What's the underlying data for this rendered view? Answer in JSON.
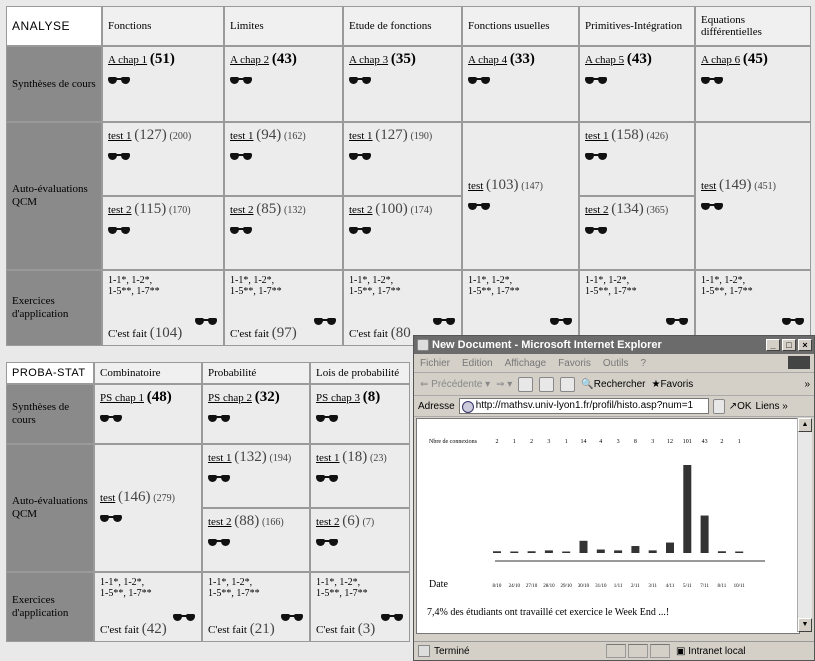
{
  "analyse": {
    "corner": "ANALYSE",
    "headers": [
      "Fonctions",
      "Limites",
      "Etude de fonctions",
      "Fonctions usuelles",
      "Primitives-Intégration",
      "Equations différentielles"
    ],
    "row_syntheses": "Synthèses de cours",
    "row_qcm": "Auto-évaluations QCM",
    "row_exercices": "Exercices d'application",
    "syntheses": [
      {
        "link": "A chap 1",
        "count": "(51)"
      },
      {
        "link": "A chap 2",
        "count": "(43)"
      },
      {
        "link": "A chap 3",
        "count": "(35)"
      },
      {
        "link": "A chap 4",
        "count": "(33)"
      },
      {
        "link": "A chap 5",
        "count": "(43)"
      },
      {
        "link": "A chap 6",
        "count": "(45)"
      }
    ],
    "test1": [
      {
        "link": "test 1",
        "count": "(127)",
        "total": "(200)"
      },
      {
        "link": "test 1",
        "count": "(94)",
        "total": "(162)"
      },
      {
        "link": "test 1",
        "count": "(127)",
        "total": "(190)"
      },
      {
        "link": "",
        "count": "",
        "total": ""
      },
      {
        "link": "test 1",
        "count": "(158)",
        "total": "(426)"
      },
      {
        "link": "",
        "count": "",
        "total": ""
      }
    ],
    "test2": [
      {
        "link": "test 2",
        "count": "(115)",
        "total": "(170)"
      },
      {
        "link": "test 2",
        "count": "(85)",
        "total": "(132)"
      },
      {
        "link": "test 2",
        "count": "(100)",
        "total": "(174)"
      },
      {
        "link": "",
        "count": "",
        "total": ""
      },
      {
        "link": "test 2",
        "count": "(134)",
        "total": "(365)"
      },
      {
        "link": "",
        "count": "",
        "total": ""
      }
    ],
    "single_tests": {
      "col4": {
        "link": "test",
        "count": "(103)",
        "total": "(147)"
      },
      "col6": {
        "link": "test",
        "count": "(149)",
        "total": "(451)"
      }
    },
    "exercices_line1": "1-1*, 1-2*,",
    "exercices_line2": "1-5**, 1-7**",
    "done_label": "C'est fait",
    "done_counts": [
      "(104)",
      "(97)",
      "(80"
    ]
  },
  "proba": {
    "corner": "PROBA-STAT",
    "headers": [
      "Combinatoire",
      "Probabilité",
      "Lois de probabilité"
    ],
    "row_syntheses": "Synthèses de cours",
    "row_qcm": "Auto-évaluations QCM",
    "row_exercices": "Exercices d'application",
    "syntheses": [
      {
        "link": "PS chap 1",
        "count": "(48)"
      },
      {
        "link": "PS chap 2",
        "count": "(32)"
      },
      {
        "link": "PS chap 3",
        "count": "(8)"
      }
    ],
    "single_test": {
      "link": "test",
      "count": "(146)",
      "total": "(279)"
    },
    "test1": [
      {
        "link": "test 1",
        "count": "(132)",
        "total": "(194)"
      },
      {
        "link": "test 1",
        "count": "(18)",
        "total": "(23)"
      }
    ],
    "test2": [
      {
        "link": "test 2",
        "count": "(88)",
        "total": "(166)"
      },
      {
        "link": "test 2",
        "count": "(6)",
        "total": "(7)"
      }
    ],
    "exercices_line1": "1-1*, 1-2*,",
    "exercices_line2": "1-5**, 1-7**",
    "done_label": "C'est fait",
    "done_counts": [
      "(42)",
      "(21)",
      "(3)"
    ]
  },
  "ie": {
    "title": "New Document - Microsoft Internet Explorer",
    "menu": [
      "Fichier",
      "Edition",
      "Affichage",
      "Favoris",
      "Outils",
      "?"
    ],
    "toolbar": {
      "back": "Précédente",
      "search": "Rechercher",
      "favorites": "Favoris"
    },
    "address_label": "Adresse",
    "address_value": "http://mathsv.univ-lyon1.fr/profil/histo.asp?num=1",
    "go_label": "OK",
    "links_label": "Liens",
    "status_text": "Terminé",
    "zone_text": "Intranet local",
    "page": {
      "note": "7,4% des étudiants ont travaillé cet exercice le Week End ...!"
    }
  },
  "chart_data": {
    "type": "bar",
    "title": "",
    "ylabel": "Nbre de connexions",
    "xlabel": "Date",
    "categories": [
      "8/10",
      "24/10",
      "27/10",
      "28/10",
      "29/10",
      "30/10",
      "31/10",
      "1/11",
      "2/11",
      "3/11",
      "4/11",
      "5/11",
      "7/11",
      "8/11",
      "10/11"
    ],
    "values": [
      2,
      1,
      2,
      3,
      1,
      14,
      4,
      3,
      8,
      3,
      12,
      101,
      43,
      2,
      1
    ],
    "value_labels": [
      "2",
      "1",
      "2",
      "3",
      "1",
      "14",
      "4",
      "3",
      "8",
      "3",
      "12",
      "101",
      "43",
      "2",
      "1"
    ],
    "bar_color": "#333333",
    "grid": false
  }
}
